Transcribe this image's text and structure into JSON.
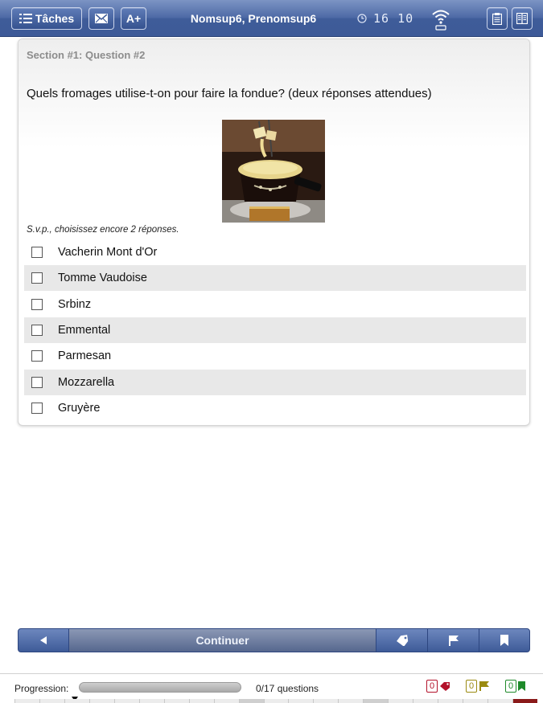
{
  "topbar": {
    "tasks_label": "Tâches",
    "font_label": "A+",
    "user_name": "Nomsup6, Prenomsup6",
    "clock_digits": "16 10",
    "mail_icon": "mail-icon",
    "clock_icon": "clock-icon",
    "wifi_icon": "wifi-icon",
    "notes_icon": "notes-icon",
    "layout_icon": "layout-icon"
  },
  "question": {
    "section_label": "Section #1: Question #2",
    "text": "Quels fromages utilise-t-on pour faire la fondue? (deux réponses attendues)",
    "image_alt": "fondue",
    "hint": "S.v.p., choisissez encore 2 réponses.",
    "options": [
      {
        "label": "Vacherin Mont d'Or",
        "checked": false
      },
      {
        "label": "Tomme Vaudoise",
        "checked": false
      },
      {
        "label": "Srbinz",
        "checked": false
      },
      {
        "label": "Emmental",
        "checked": false
      },
      {
        "label": "Parmesan",
        "checked": false
      },
      {
        "label": "Mozzarella",
        "checked": false
      },
      {
        "label": "Gruyère",
        "checked": false
      }
    ]
  },
  "nav": {
    "continue_label": "Continuer"
  },
  "footer": {
    "progress_label": "Progression:",
    "progress_fraction": 0,
    "questions_count": "0/17 questions",
    "tag_count": "0",
    "flag_count": "0",
    "bookmark_count": "0"
  },
  "colors": {
    "brand": "#3d5a98",
    "tag": "#b3122a",
    "flag": "#9a8a10",
    "bookmark": "#1e8a2a"
  }
}
